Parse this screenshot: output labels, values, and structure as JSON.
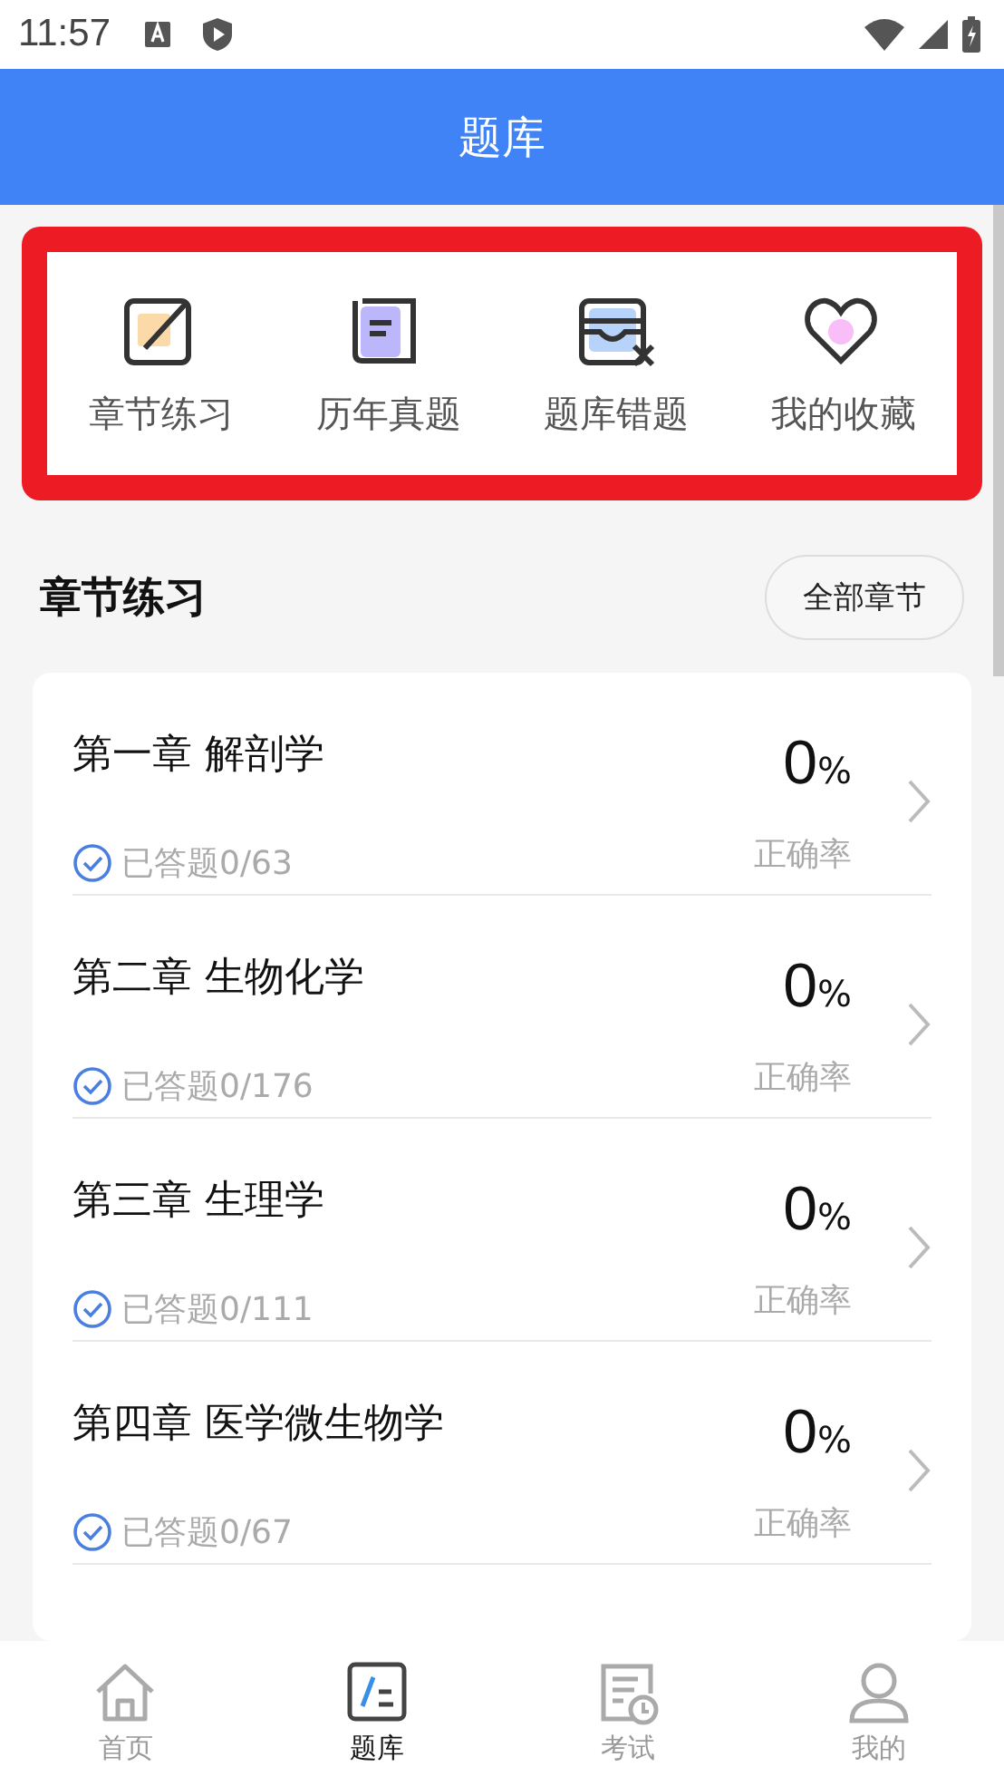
{
  "status_bar": {
    "time": "11:57"
  },
  "header": {
    "title": "题库"
  },
  "quick_menu": [
    {
      "kind": "practice",
      "label": "章节练习"
    },
    {
      "kind": "papers",
      "label": "历年真题"
    },
    {
      "kind": "mistakes",
      "label": "题库错题"
    },
    {
      "kind": "favorites",
      "label": "我的收藏"
    }
  ],
  "section": {
    "title": "章节练习",
    "button": "全部章节"
  },
  "chapters": [
    {
      "title": "第一章 解剖学",
      "answered": "已答题0/63",
      "rate": "0",
      "unit": "%",
      "rate_label": "正确率"
    },
    {
      "title": "第二章 生物化学",
      "answered": "已答题0/176",
      "rate": "0",
      "unit": "%",
      "rate_label": "正确率"
    },
    {
      "title": "第三章 生理学",
      "answered": "已答题0/111",
      "rate": "0",
      "unit": "%",
      "rate_label": "正确率"
    },
    {
      "title": "第四章 医学微生物学",
      "answered": "已答题0/67",
      "rate": "0",
      "unit": "%",
      "rate_label": "正确率"
    }
  ],
  "tab_bar": [
    {
      "kind": "home",
      "label": "首页",
      "selected": false
    },
    {
      "kind": "bank",
      "label": "题库",
      "selected": true
    },
    {
      "kind": "exam",
      "label": "考试",
      "selected": false
    },
    {
      "kind": "me",
      "label": "我的",
      "selected": false
    }
  ]
}
